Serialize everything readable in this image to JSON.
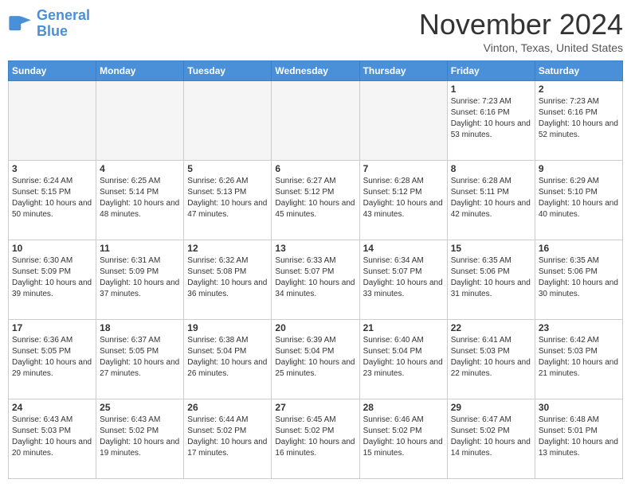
{
  "header": {
    "logo_line1": "General",
    "logo_line2": "Blue",
    "month_title": "November 2024",
    "location": "Vinton, Texas, United States"
  },
  "days_of_week": [
    "Sunday",
    "Monday",
    "Tuesday",
    "Wednesday",
    "Thursday",
    "Friday",
    "Saturday"
  ],
  "weeks": [
    [
      {
        "day": "",
        "empty": true
      },
      {
        "day": "",
        "empty": true
      },
      {
        "day": "",
        "empty": true
      },
      {
        "day": "",
        "empty": true
      },
      {
        "day": "",
        "empty": true
      },
      {
        "day": "1",
        "sunrise": "Sunrise: 7:23 AM",
        "sunset": "Sunset: 6:16 PM",
        "daylight": "Daylight: 10 hours and 53 minutes."
      },
      {
        "day": "2",
        "sunrise": "Sunrise: 7:23 AM",
        "sunset": "Sunset: 6:16 PM",
        "daylight": "Daylight: 10 hours and 52 minutes."
      }
    ],
    [
      {
        "day": "3",
        "sunrise": "Sunrise: 6:24 AM",
        "sunset": "Sunset: 5:15 PM",
        "daylight": "Daylight: 10 hours and 50 minutes."
      },
      {
        "day": "4",
        "sunrise": "Sunrise: 6:25 AM",
        "sunset": "Sunset: 5:14 PM",
        "daylight": "Daylight: 10 hours and 48 minutes."
      },
      {
        "day": "5",
        "sunrise": "Sunrise: 6:26 AM",
        "sunset": "Sunset: 5:13 PM",
        "daylight": "Daylight: 10 hours and 47 minutes."
      },
      {
        "day": "6",
        "sunrise": "Sunrise: 6:27 AM",
        "sunset": "Sunset: 5:12 PM",
        "daylight": "Daylight: 10 hours and 45 minutes."
      },
      {
        "day": "7",
        "sunrise": "Sunrise: 6:28 AM",
        "sunset": "Sunset: 5:12 PM",
        "daylight": "Daylight: 10 hours and 43 minutes."
      },
      {
        "day": "8",
        "sunrise": "Sunrise: 6:28 AM",
        "sunset": "Sunset: 5:11 PM",
        "daylight": "Daylight: 10 hours and 42 minutes."
      },
      {
        "day": "9",
        "sunrise": "Sunrise: 6:29 AM",
        "sunset": "Sunset: 5:10 PM",
        "daylight": "Daylight: 10 hours and 40 minutes."
      }
    ],
    [
      {
        "day": "10",
        "sunrise": "Sunrise: 6:30 AM",
        "sunset": "Sunset: 5:09 PM",
        "daylight": "Daylight: 10 hours and 39 minutes."
      },
      {
        "day": "11",
        "sunrise": "Sunrise: 6:31 AM",
        "sunset": "Sunset: 5:09 PM",
        "daylight": "Daylight: 10 hours and 37 minutes."
      },
      {
        "day": "12",
        "sunrise": "Sunrise: 6:32 AM",
        "sunset": "Sunset: 5:08 PM",
        "daylight": "Daylight: 10 hours and 36 minutes."
      },
      {
        "day": "13",
        "sunrise": "Sunrise: 6:33 AM",
        "sunset": "Sunset: 5:07 PM",
        "daylight": "Daylight: 10 hours and 34 minutes."
      },
      {
        "day": "14",
        "sunrise": "Sunrise: 6:34 AM",
        "sunset": "Sunset: 5:07 PM",
        "daylight": "Daylight: 10 hours and 33 minutes."
      },
      {
        "day": "15",
        "sunrise": "Sunrise: 6:35 AM",
        "sunset": "Sunset: 5:06 PM",
        "daylight": "Daylight: 10 hours and 31 minutes."
      },
      {
        "day": "16",
        "sunrise": "Sunrise: 6:35 AM",
        "sunset": "Sunset: 5:06 PM",
        "daylight": "Daylight: 10 hours and 30 minutes."
      }
    ],
    [
      {
        "day": "17",
        "sunrise": "Sunrise: 6:36 AM",
        "sunset": "Sunset: 5:05 PM",
        "daylight": "Daylight: 10 hours and 29 minutes."
      },
      {
        "day": "18",
        "sunrise": "Sunrise: 6:37 AM",
        "sunset": "Sunset: 5:05 PM",
        "daylight": "Daylight: 10 hours and 27 minutes."
      },
      {
        "day": "19",
        "sunrise": "Sunrise: 6:38 AM",
        "sunset": "Sunset: 5:04 PM",
        "daylight": "Daylight: 10 hours and 26 minutes."
      },
      {
        "day": "20",
        "sunrise": "Sunrise: 6:39 AM",
        "sunset": "Sunset: 5:04 PM",
        "daylight": "Daylight: 10 hours and 25 minutes."
      },
      {
        "day": "21",
        "sunrise": "Sunrise: 6:40 AM",
        "sunset": "Sunset: 5:04 PM",
        "daylight": "Daylight: 10 hours and 23 minutes."
      },
      {
        "day": "22",
        "sunrise": "Sunrise: 6:41 AM",
        "sunset": "Sunset: 5:03 PM",
        "daylight": "Daylight: 10 hours and 22 minutes."
      },
      {
        "day": "23",
        "sunrise": "Sunrise: 6:42 AM",
        "sunset": "Sunset: 5:03 PM",
        "daylight": "Daylight: 10 hours and 21 minutes."
      }
    ],
    [
      {
        "day": "24",
        "sunrise": "Sunrise: 6:43 AM",
        "sunset": "Sunset: 5:03 PM",
        "daylight": "Daylight: 10 hours and 20 minutes."
      },
      {
        "day": "25",
        "sunrise": "Sunrise: 6:43 AM",
        "sunset": "Sunset: 5:02 PM",
        "daylight": "Daylight: 10 hours and 19 minutes."
      },
      {
        "day": "26",
        "sunrise": "Sunrise: 6:44 AM",
        "sunset": "Sunset: 5:02 PM",
        "daylight": "Daylight: 10 hours and 17 minutes."
      },
      {
        "day": "27",
        "sunrise": "Sunrise: 6:45 AM",
        "sunset": "Sunset: 5:02 PM",
        "daylight": "Daylight: 10 hours and 16 minutes."
      },
      {
        "day": "28",
        "sunrise": "Sunrise: 6:46 AM",
        "sunset": "Sunset: 5:02 PM",
        "daylight": "Daylight: 10 hours and 15 minutes."
      },
      {
        "day": "29",
        "sunrise": "Sunrise: 6:47 AM",
        "sunset": "Sunset: 5:02 PM",
        "daylight": "Daylight: 10 hours and 14 minutes."
      },
      {
        "day": "30",
        "sunrise": "Sunrise: 6:48 AM",
        "sunset": "Sunset: 5:01 PM",
        "daylight": "Daylight: 10 hours and 13 minutes."
      }
    ]
  ]
}
